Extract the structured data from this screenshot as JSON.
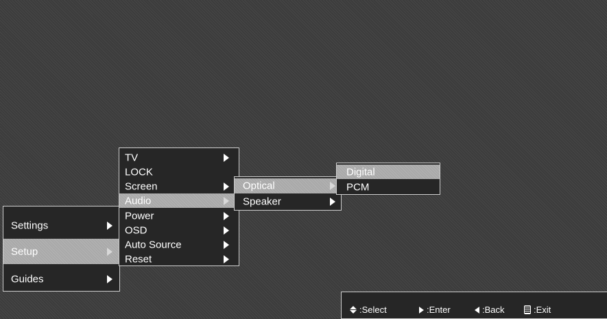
{
  "main_menu": {
    "items": [
      {
        "label": "Settings",
        "highlighted": false
      },
      {
        "label": "Setup",
        "highlighted": true
      },
      {
        "label": "Guides",
        "highlighted": false
      }
    ]
  },
  "setup_menu": {
    "items": [
      {
        "label": "TV",
        "highlighted": false
      },
      {
        "label": "LOCK",
        "highlighted": false
      },
      {
        "label": "Screen",
        "highlighted": false
      },
      {
        "label": "Audio",
        "highlighted": true
      },
      {
        "label": "Power",
        "highlighted": false
      },
      {
        "label": "OSD",
        "highlighted": false
      },
      {
        "label": "Auto Source",
        "highlighted": false
      },
      {
        "label": "Reset",
        "highlighted": false
      }
    ]
  },
  "audio_menu": {
    "items": [
      {
        "label": "Optical",
        "highlighted": true
      },
      {
        "label": "Speaker",
        "highlighted": false
      }
    ]
  },
  "optical_menu": {
    "items": [
      {
        "label": "Digital",
        "highlighted": true
      },
      {
        "label": "PCM",
        "highlighted": false
      }
    ]
  },
  "help_bar": {
    "select": ":Select",
    "enter": ":Enter",
    "back": ":Back",
    "exit": ":Exit"
  },
  "colors": {
    "background": "#3c3c3c",
    "menu_bg": "#262626",
    "highlight": "#a9a9a9",
    "border": "#cfcfcf"
  },
  "icons": {
    "submenu": "right-triangle-arrow",
    "select": "up-down-arrows",
    "enter": "right-triangle",
    "back": "left-triangle",
    "exit": "menu-list-icon"
  }
}
